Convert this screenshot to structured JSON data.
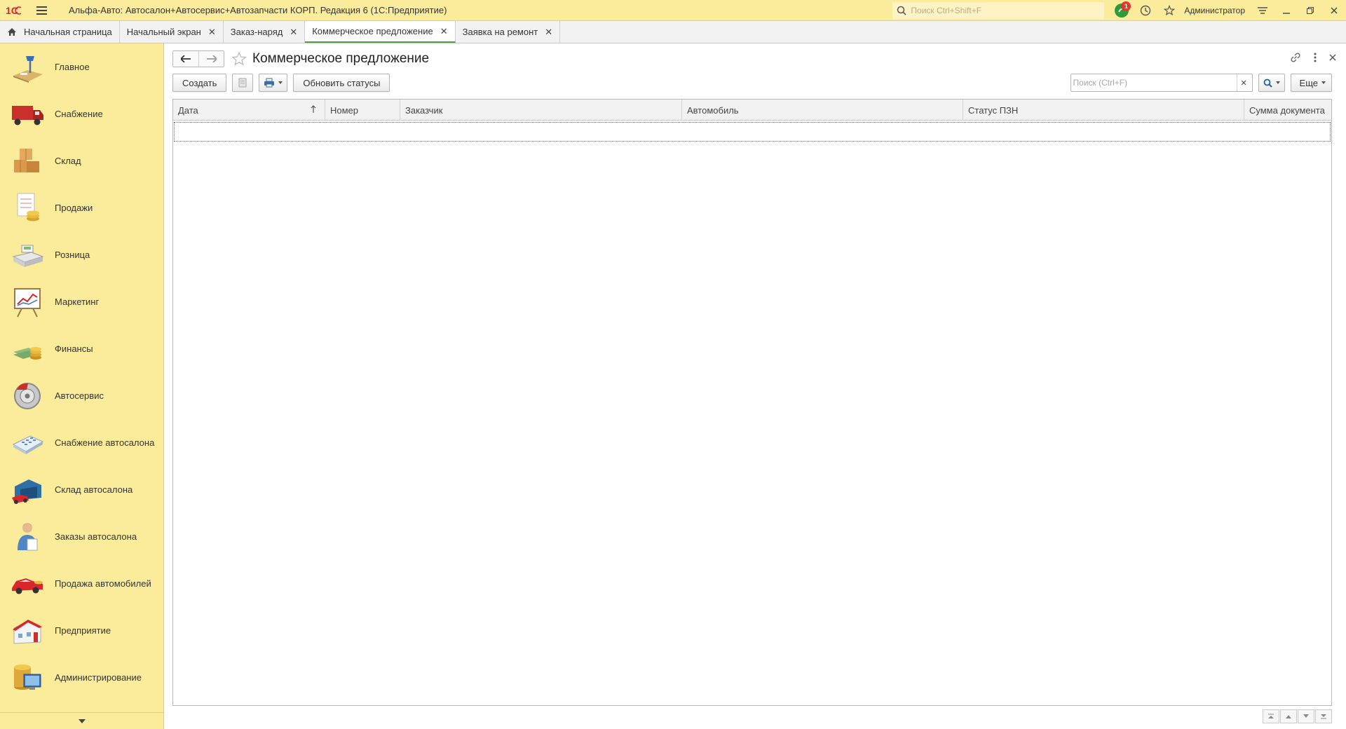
{
  "titlebar": {
    "logo_text": "1С",
    "app_title": "Альфа-Авто: Автосалон+Автосервис+Автозапчасти КОРП. Редакция 6  (1С:Предприятие)",
    "search_placeholder": "Поиск Ctrl+Shift+F",
    "notification_count": "1",
    "user_name": "Администратор"
  },
  "tabs": [
    {
      "label": "Начальная страница"
    },
    {
      "label": "Начальный экран"
    },
    {
      "label": "Заказ-наряд"
    },
    {
      "label": "Коммерческое предложение"
    },
    {
      "label": "Заявка на ремонт"
    }
  ],
  "sidebar": {
    "items": [
      {
        "label": "Главное",
        "icon": "desk-lamp-icon"
      },
      {
        "label": "Снабжение",
        "icon": "truck-icon"
      },
      {
        "label": "Склад",
        "icon": "boxes-icon"
      },
      {
        "label": "Продажи",
        "icon": "sales-chart-icon"
      },
      {
        "label": "Розница",
        "icon": "cash-register-icon"
      },
      {
        "label": "Маркетинг",
        "icon": "flipchart-icon"
      },
      {
        "label": "Финансы",
        "icon": "money-icon"
      },
      {
        "label": "Автосервис",
        "icon": "brake-disc-icon"
      },
      {
        "label": "Снабжение автосалона",
        "icon": "calculator-icon"
      },
      {
        "label": "Склад автосалона",
        "icon": "garage-icon"
      },
      {
        "label": "Заказы автосалона",
        "icon": "person-icon"
      },
      {
        "label": "Продажа автомобилей",
        "icon": "car-icon"
      },
      {
        "label": "Предприятие",
        "icon": "building-icon"
      },
      {
        "label": "Администрирование",
        "icon": "admin-computer-icon"
      }
    ]
  },
  "form": {
    "title": "Коммерческое предложение",
    "toolbar": {
      "create_label": "Создать",
      "update_statuses_label": "Обновить статусы",
      "search_placeholder": "Поиск (Ctrl+F)",
      "more_label": "Еще"
    },
    "table": {
      "columns": [
        "Дата",
        "Номер",
        "Заказчик",
        "Автомобиль",
        "Статус ПЗН",
        "Сумма документа"
      ],
      "sorted_column": "Дата",
      "sort_direction": "ascending",
      "rows": []
    }
  },
  "colors": {
    "sidebar_bg": "#fbec9c",
    "titlebar_bg": "#fbec9c",
    "active_tab_underline": "#4fa13e",
    "badge": "#e03a2f"
  }
}
